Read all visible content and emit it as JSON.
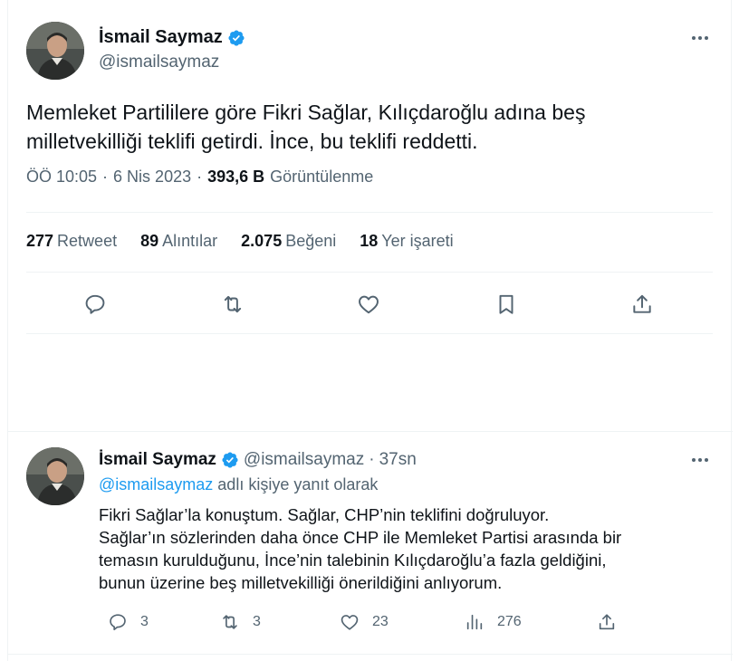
{
  "main_tweet": {
    "author": {
      "display_name": "İsmail Saymaz",
      "handle": "@ismailsaymaz",
      "verified": true
    },
    "text_line1": "Memleket Partililere göre Fikri Sağlar, Kılıçdaroğlu adına beş",
    "text_line2": "milletvekilliği teklifi getirdi. İnce, bu teklifi reddetti.",
    "time": "ÖÖ 10:05",
    "dot1": "·",
    "date": "6 Nis 2023",
    "dot2": "·",
    "views_count": "393,6 B",
    "views_label": "Görüntülenme",
    "stats": [
      {
        "num": "277",
        "label": "Retweet"
      },
      {
        "num": "89",
        "label": "Alıntılar"
      },
      {
        "num": "2.075",
        "label": "Beğeni"
      },
      {
        "num": "18",
        "label": "Yer işareti"
      }
    ],
    "actions": [
      "reply-icon",
      "retweet-icon",
      "like-icon",
      "bookmark-icon",
      "share-icon"
    ]
  },
  "reply_tweet": {
    "author": {
      "display_name": "İsmail Saymaz",
      "handle": "@ismailsaymaz",
      "verified": true
    },
    "separator": "·",
    "time_ago": "37sn",
    "replying_mention": "@ismailsaymaz",
    "replying_suffix": " adlı kişiye yanıt olarak",
    "lines": [
      "Fikri Sağlar’la konuştum. Sağlar, CHP’nin teklifini doğruluyor.",
      "Sağlar’ın sözlerinden daha önce CHP ile Memleket Partisi arasında bir",
      "temasın kurulduğunu, İnce’nin talebinin Kılıçdaroğlu’a fazla geldiğini,",
      "bunun üzerine beş milletvekilliği önerildiğini anlıyorum."
    ],
    "reply_count": "3",
    "retweet_count": "3",
    "like_count": "23",
    "view_count": "276"
  },
  "colors": {
    "accent": "#1d9bf0",
    "secondary_text": "#536471",
    "primary_text": "#0f1419",
    "border": "#eff3f4"
  }
}
